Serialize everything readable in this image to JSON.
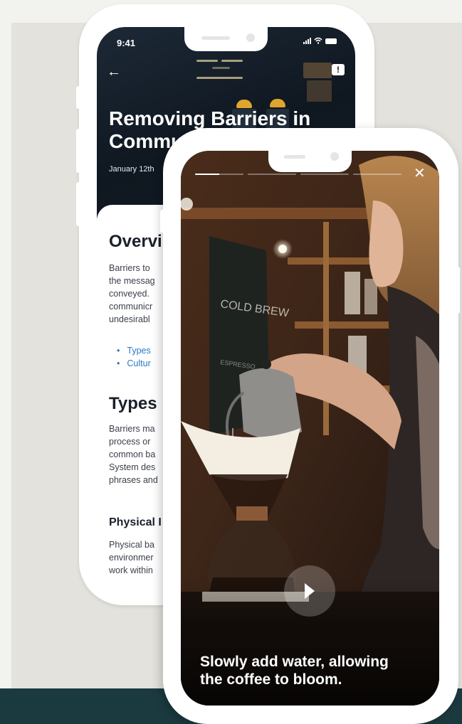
{
  "article": {
    "status_time": "9:41",
    "title_line1": "Removing Barriers in",
    "title_line2": "Commu",
    "date": "January 12th",
    "overview_heading": "Overvi",
    "overview_lines": [
      "Barriers to",
      "the messag",
      "conveyed.",
      "communicr",
      "undesirabl"
    ],
    "links": [
      "Types",
      "Cultur"
    ],
    "types_heading": "Types",
    "types_lines": [
      "Barriers ma",
      "process or",
      "common ba",
      "System des",
      "phrases and"
    ],
    "physical_heading": "Physical I",
    "physical_lines": [
      "Physical ba",
      "environmer",
      "work within"
    ]
  },
  "story": {
    "progress_segments": [
      0.5,
      0,
      0,
      0
    ],
    "caption": "Slowly add water, allowing the coffee to bloom."
  },
  "colors": {
    "bottom_band": "#1b3a3f",
    "link": "#2a79c4"
  },
  "icons": [
    "back-arrow-icon",
    "report-icon",
    "signal-icon",
    "wifi-icon",
    "battery-icon",
    "close-icon",
    "play-icon"
  ]
}
